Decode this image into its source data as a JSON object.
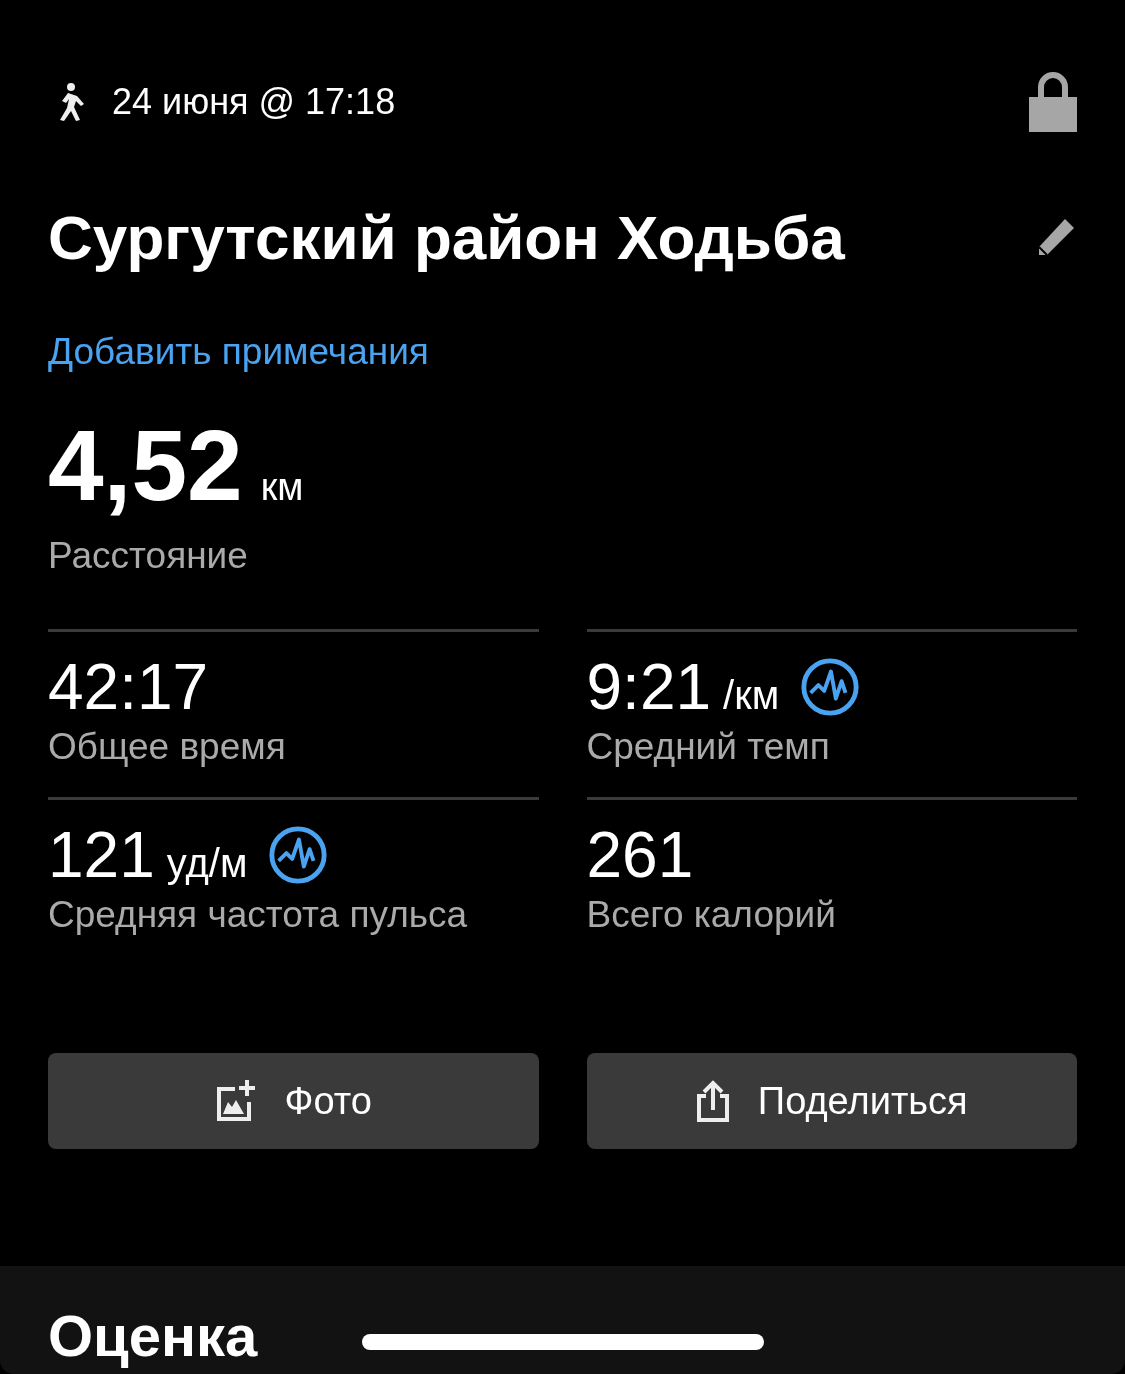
{
  "header": {
    "datetime": "24 июня @ 17:18"
  },
  "title": "Сургутский район Ходьба",
  "notes_link": "Добавить примечания",
  "distance": {
    "value": "4,52",
    "unit": "км",
    "label": "Расстояние"
  },
  "stats": [
    {
      "value": "42:17",
      "label": "Общее время",
      "chart_icon": false
    },
    {
      "value": "9:21",
      "unit": "/км",
      "label": "Средний темп",
      "chart_icon": true
    },
    {
      "value": "121",
      "unit": "уд/м",
      "label": "Средняя частота пульса",
      "chart_icon": true
    },
    {
      "value": "261",
      "label": "Всего калорий",
      "chart_icon": false
    }
  ],
  "buttons": [
    {
      "kind": "photo",
      "label": "Фото"
    },
    {
      "kind": "share",
      "label": "Поделиться"
    }
  ],
  "section": {
    "title": "Оценка"
  }
}
